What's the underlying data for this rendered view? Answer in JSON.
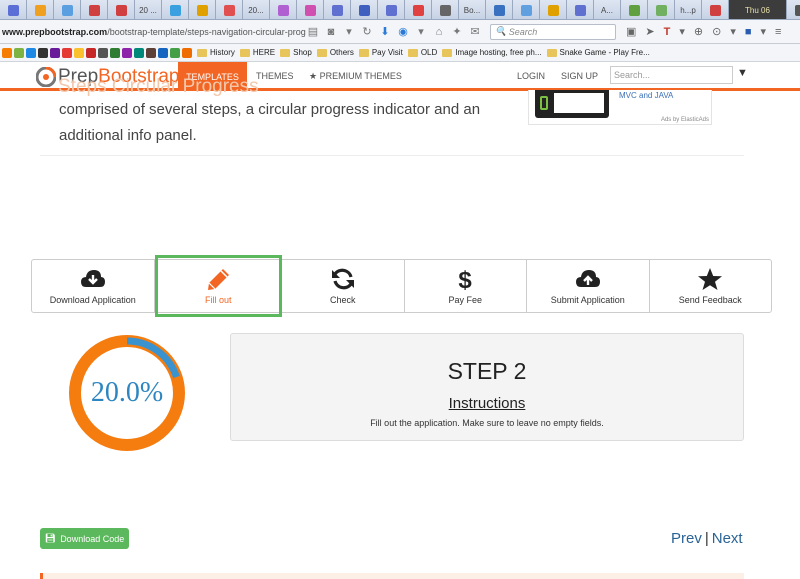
{
  "browser": {
    "tabs": [
      "",
      "",
      "",
      "",
      "",
      "20 ...",
      "",
      "",
      "",
      "20...",
      "",
      "",
      "",
      "",
      "",
      "",
      "",
      "Bo...",
      "",
      "",
      "",
      "",
      "A...",
      "",
      "",
      "h...p",
      "",
      "Thu 06",
      ""
    ],
    "url": {
      "host": "www.prepbootstrap.com",
      "path": "/bootstrap-template/steps-navigation-circular-progressbar-details"
    },
    "search_placeholder": "Search",
    "bookmarks": [
      "History",
      "HERE",
      "Shop",
      "Others",
      "Pay Visit",
      "OLD",
      "Image hosting, free ph...",
      "Snake Game - Play Fre..."
    ]
  },
  "site_nav": {
    "logo_prep": "Prep",
    "logo_bootstrap": "Bootstrap",
    "templates": "TEMPLATES",
    "themes": "THEMES",
    "premium": "PREMIUM THEMES",
    "login": "LOGIN",
    "signup": "SIGN UP",
    "search_placeholder": "Search...",
    "accent": "#f26522"
  },
  "intro": {
    "hidden_title": "Steps Circular Progress",
    "text": "comprised of several steps, a circular progress indicator and an additional info panel."
  },
  "ad": {
    "text": "MVC and JAVA",
    "by": "Ads by ElasticAds"
  },
  "steps": [
    {
      "label": "Download Application",
      "icon": "cloud-download-icon"
    },
    {
      "label": "Fill out",
      "icon": "pencil-icon",
      "active": true
    },
    {
      "label": "Check",
      "icon": "refresh-icon"
    },
    {
      "label": "Pay Fee",
      "icon": "dollar-icon"
    },
    {
      "label": "Submit Application",
      "icon": "cloud-upload-icon"
    },
    {
      "label": "Send Feedback",
      "icon": "star-icon"
    }
  ],
  "progress": {
    "value": 0.2,
    "label": "20.0%",
    "track_color": "#f57c0f",
    "fill_color": "#3a93cf"
  },
  "info": {
    "step": "STEP 2",
    "title": "Instructions",
    "description": "Fill out the application. Make sure to leave no empty fields."
  },
  "download_button": "Download Code",
  "pager": {
    "prev": "Prev",
    "separator": "|",
    "next": "Next"
  }
}
